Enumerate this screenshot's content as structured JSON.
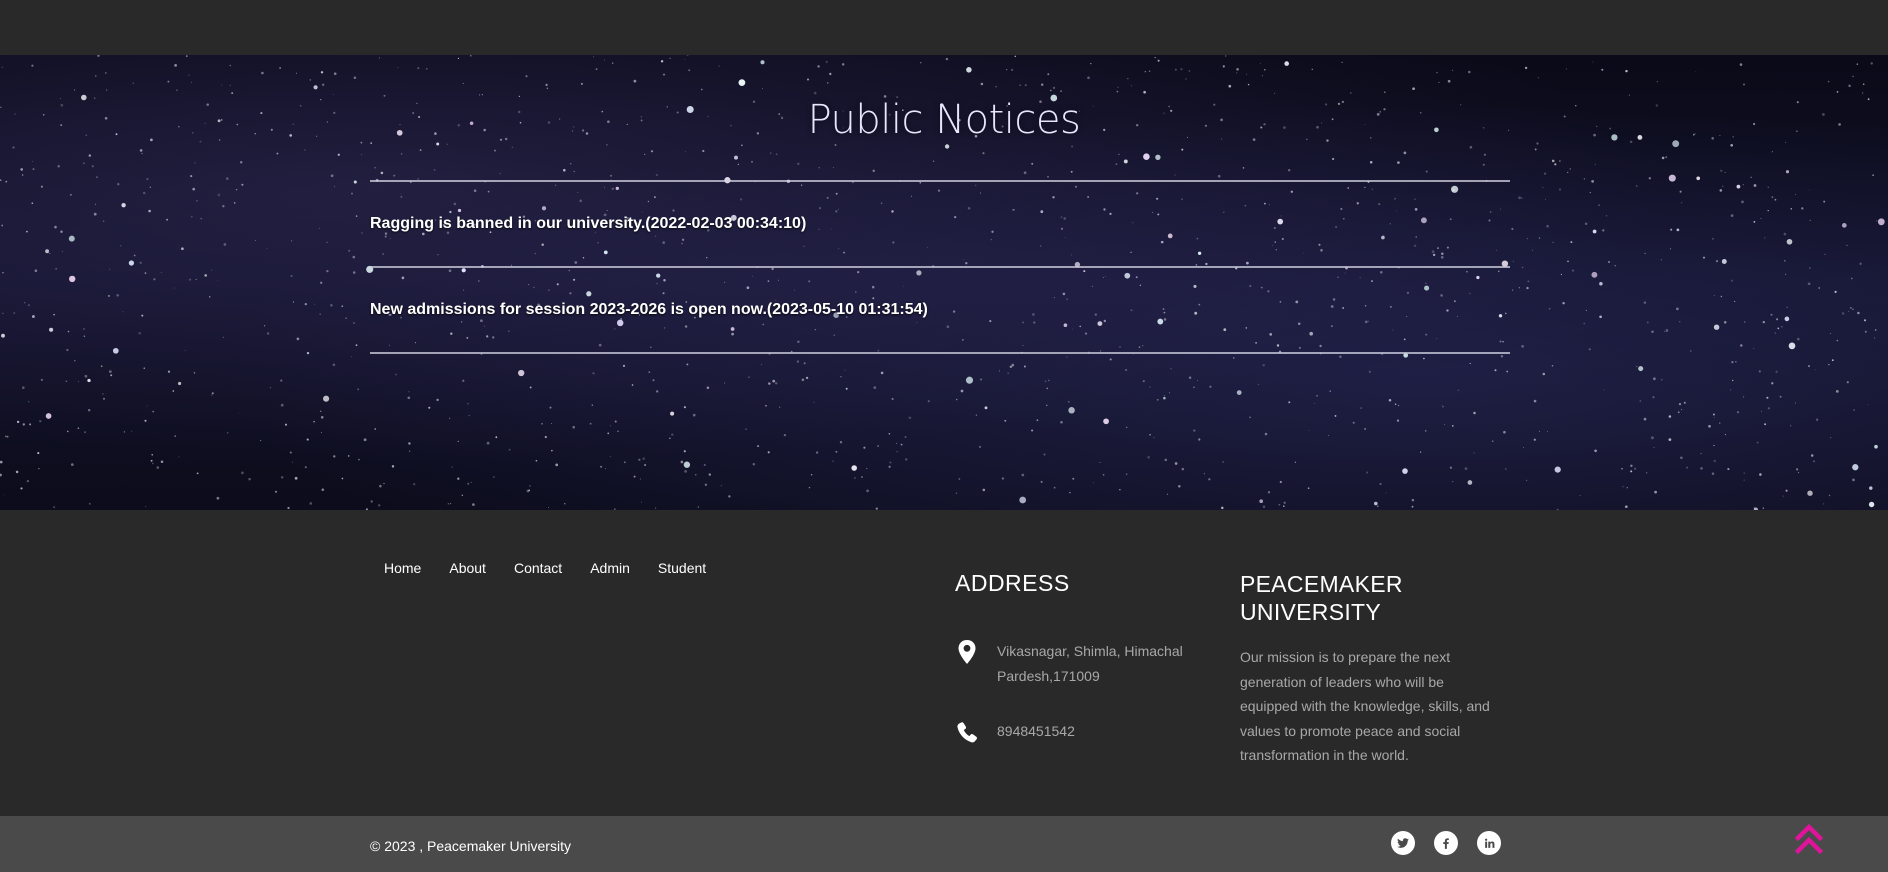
{
  "hero": {
    "title": "Public Notices",
    "notices": [
      {
        "text": "Ragging is banned in our university.(2022-02-03 00:34:10)"
      },
      {
        "text": "New admissions for session 2023-2026 is open now.(2023-05-10 01:31:54)"
      }
    ]
  },
  "footer": {
    "nav": [
      "Home",
      "About",
      "Contact",
      "Admin",
      "Student"
    ],
    "address": {
      "title": "ADDRESS",
      "location": "Vikasnagar, Shimla, Himachal Pardesh,171009",
      "phone": "8948451542",
      "location_icon": "map-pin-icon",
      "phone_icon": "phone-icon"
    },
    "university": {
      "title": "PEACEMAKER UNIVERSITY",
      "mission": "Our mission is to prepare the next generation of leaders who will be equipped with the knowledge, skills, and values to promote peace and social transformation in the world."
    }
  },
  "bottom": {
    "copyright": "© 2023 , Peacemaker University",
    "socials": [
      "twitter-icon",
      "facebook-icon",
      "linkedin-icon"
    ],
    "back_to_top_icon": "double-chevron-up-icon"
  },
  "colors": {
    "background": "#292929",
    "bottom_bar": "#4a4a4a",
    "accent": "#e0149a",
    "muted_text": "#a8a8a8"
  }
}
